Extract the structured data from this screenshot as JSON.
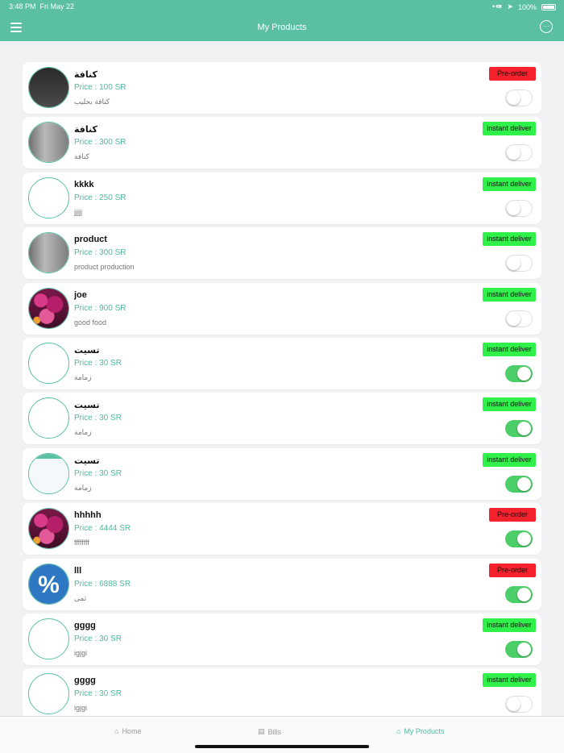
{
  "status_bar": {
    "time": "3:48 PM",
    "date": "Fri May 22",
    "battery": "100%"
  },
  "header": {
    "title": "My Products"
  },
  "products": [
    {
      "name": "كنافة",
      "price": "Price : 100 SR",
      "desc": "كنافة بحليب",
      "badge": "Pre-order",
      "badge_type": "pre",
      "enabled": false,
      "pic": "dark"
    },
    {
      "name": "كنافة",
      "price": "Price : 300 SR",
      "desc": "كنافة",
      "badge": "instant deliver",
      "badge_type": "inst",
      "enabled": false,
      "pic": "grey"
    },
    {
      "name": "kkkk",
      "price": "Price : 250 SR",
      "desc": "jjjjj",
      "badge": "instant deliver",
      "badge_type": "inst",
      "enabled": false,
      "pic": "none"
    },
    {
      "name": "product",
      "price": "Price : 300 SR",
      "desc": "product  production",
      "badge": "instant deliver",
      "badge_type": "inst",
      "enabled": false,
      "pic": "grey"
    },
    {
      "name": "joe",
      "price": "Price : 900 SR",
      "desc": "good food",
      "badge": "instant deliver",
      "badge_type": "inst",
      "enabled": false,
      "pic": "flowers"
    },
    {
      "name": "تسيت",
      "price": "Price : 30 SR",
      "desc": "زمامة",
      "badge": "instant deliver",
      "badge_type": "inst",
      "enabled": true,
      "pic": "none"
    },
    {
      "name": "تسيت",
      "price": "Price : 30 SR",
      "desc": "زمامة",
      "badge": "instant deliver",
      "badge_type": "inst",
      "enabled": true,
      "pic": "none"
    },
    {
      "name": "تسيت",
      "price": "Price : 30 SR",
      "desc": "زمامة",
      "badge": "instant deliver",
      "badge_type": "inst",
      "enabled": true,
      "pic": "list"
    },
    {
      "name": "hhhhh",
      "price": "Price : 4444 SR",
      "desc": "ffffffff",
      "badge": "Pre-order",
      "badge_type": "pre",
      "enabled": true,
      "pic": "flowers"
    },
    {
      "name": "lll",
      "price": "Price : 6888 SR",
      "desc": "ثمى",
      "badge": "Pre-order",
      "badge_type": "pre",
      "enabled": true,
      "pic": "percent"
    },
    {
      "name": "gggg",
      "price": "Price : 30 SR",
      "desc": "igjgi",
      "badge": "instant deliver",
      "badge_type": "inst",
      "enabled": true,
      "pic": "none"
    },
    {
      "name": "gggg",
      "price": "Price : 30 SR",
      "desc": "igjgi",
      "badge": "instant deliver",
      "badge_type": "inst",
      "enabled": false,
      "pic": "none"
    }
  ],
  "tabbar": {
    "home": "Home",
    "bills": "Bills",
    "my_products": "My Products"
  }
}
